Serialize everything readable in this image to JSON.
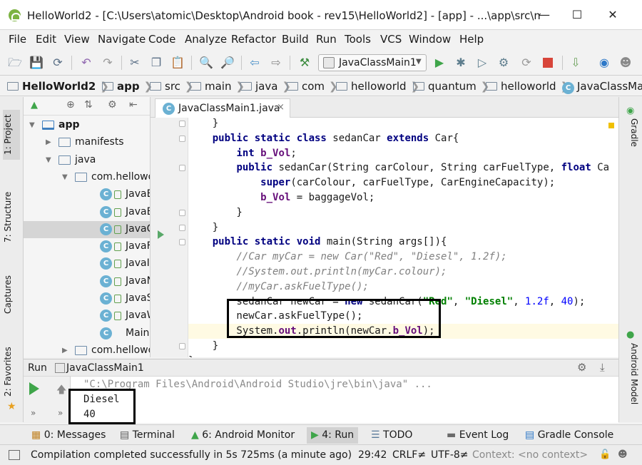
{
  "window": {
    "title": "HelloWorld2 - [C:\\Users\\atomic\\Desktop\\Android book - rev15\\HelloWorld2] - [app] - ...\\app\\src\\main...",
    "minimize": "—",
    "maximize": "☐",
    "close": "✕"
  },
  "menu": [
    "File",
    "Edit",
    "View",
    "Navigate",
    "Code",
    "Analyze",
    "Refactor",
    "Build",
    "Run",
    "Tools",
    "VCS",
    "Window",
    "Help"
  ],
  "toolbar": {
    "run_config": "JavaClassMain1",
    "icons": [
      "open-icon",
      "save-icon",
      "sync-icon",
      "undo-icon",
      "redo-icon",
      "cut-icon",
      "copy-icon",
      "paste-icon",
      "find-icon",
      "replace-icon",
      "back-icon",
      "forward-icon",
      "build-icon",
      "run-icon",
      "debug-icon",
      "coverage-icon",
      "profile-icon",
      "attach-icon",
      "stop-icon",
      "sdk-icon",
      "avatar-icon"
    ]
  },
  "breadcrumb": [
    "HelloWorld2",
    "app",
    "src",
    "main",
    "java",
    "com",
    "helloworld",
    "quantum",
    "helloworld",
    "JavaClassMa"
  ],
  "left_strip": {
    "project": "1: Project",
    "structure": "7: Structure",
    "captures": "Captures",
    "favorites": "2: Favorites"
  },
  "right_strip": {
    "gradle": "Gradle",
    "android_model": "Android Model"
  },
  "project_tree": [
    {
      "label": "app",
      "kind": "module",
      "indent": 0,
      "expanded": true
    },
    {
      "label": "manifests",
      "kind": "folder",
      "indent": 1,
      "expanded": false
    },
    {
      "label": "java",
      "kind": "folder",
      "indent": 1,
      "expanded": true
    },
    {
      "label": "com.hellowo",
      "kind": "package",
      "indent": 2,
      "expanded": true
    },
    {
      "label": "JavaB",
      "kind": "class",
      "indent": 3
    },
    {
      "label": "JavaB",
      "kind": "class",
      "indent": 3
    },
    {
      "label": "JavaC",
      "kind": "class",
      "indent": 3,
      "selected": true
    },
    {
      "label": "JavaF",
      "kind": "class",
      "indent": 3
    },
    {
      "label": "JavaIf",
      "kind": "class",
      "indent": 3
    },
    {
      "label": "JavaN",
      "kind": "class",
      "indent": 3
    },
    {
      "label": "JavaS",
      "kind": "class",
      "indent": 3
    },
    {
      "label": "JavaW",
      "kind": "class",
      "indent": 3
    },
    {
      "label": "Main",
      "kind": "class",
      "indent": 3
    },
    {
      "label": "com.hellowo",
      "kind": "package",
      "indent": 2,
      "expanded": false
    }
  ],
  "editor": {
    "tab": "JavaClassMain1.java",
    "tab_close": "×",
    "lines": [
      [
        {
          "t": "    }",
          "c": ""
        }
      ],
      [
        {
          "t": "    ",
          "c": ""
        },
        {
          "t": "public static class ",
          "c": "kw"
        },
        {
          "t": "sedanCar ",
          "c": ""
        },
        {
          "t": "extends ",
          "c": "kw"
        },
        {
          "t": "Car{",
          "c": ""
        }
      ],
      [
        {
          "t": "        ",
          "c": ""
        },
        {
          "t": "int ",
          "c": "kw"
        },
        {
          "t": "b_Vol",
          "c": "fld"
        },
        {
          "t": ";",
          "c": ""
        }
      ],
      [
        {
          "t": "        ",
          "c": ""
        },
        {
          "t": "public ",
          "c": "kw"
        },
        {
          "t": "sedanCar(String carColour, String carFuelType, ",
          "c": ""
        },
        {
          "t": "float ",
          "c": "kw"
        },
        {
          "t": "Ca",
          "c": ""
        }
      ],
      [
        {
          "t": "            ",
          "c": ""
        },
        {
          "t": "super",
          "c": "kw"
        },
        {
          "t": "(carColour, carFuelType, CarEngineCapacity);",
          "c": ""
        }
      ],
      [
        {
          "t": "            ",
          "c": ""
        },
        {
          "t": "b_Vol",
          "c": "fld"
        },
        {
          "t": " = baggageVol;",
          "c": ""
        }
      ],
      [
        {
          "t": "        }",
          "c": ""
        }
      ],
      [
        {
          "t": "    }",
          "c": ""
        }
      ],
      [
        {
          "t": "    ",
          "c": ""
        },
        {
          "t": "public static void ",
          "c": "kw"
        },
        {
          "t": "main(String args[]){",
          "c": ""
        }
      ],
      [
        {
          "t": "        ",
          "c": ""
        },
        {
          "t": "//Car myCar = new Car(\"Red\", \"Diesel\", 1.2f);",
          "c": "cm"
        }
      ],
      [
        {
          "t": "        ",
          "c": ""
        },
        {
          "t": "//System.out.println(myCar.colour);",
          "c": "cm"
        }
      ],
      [
        {
          "t": "        ",
          "c": ""
        },
        {
          "t": "//myCar.askFuelType();",
          "c": "cm"
        }
      ],
      [
        {
          "t": "        sedanCar newCar = ",
          "c": ""
        },
        {
          "t": "new ",
          "c": "kw"
        },
        {
          "t": "sedanCar(",
          "c": ""
        },
        {
          "t": "\"Red\"",
          "c": "str"
        },
        {
          "t": ", ",
          "c": ""
        },
        {
          "t": "\"Diesel\"",
          "c": "str"
        },
        {
          "t": ", ",
          "c": ""
        },
        {
          "t": "1.2f",
          "c": "num"
        },
        {
          "t": ", ",
          "c": ""
        },
        {
          "t": "40",
          "c": "num"
        },
        {
          "t": ");",
          "c": ""
        }
      ],
      [
        {
          "t": "        newCar.askFuelType();",
          "c": ""
        }
      ],
      [
        {
          "t": "        System.",
          "c": ""
        },
        {
          "t": "out",
          "c": "fld"
        },
        {
          "t": ".println(newCar.",
          "c": ""
        },
        {
          "t": "b_Vol",
          "c": "fld"
        },
        {
          "t": ");",
          "c": ""
        }
      ],
      [
        {
          "t": "    }",
          "c": ""
        }
      ],
      [
        {
          "t": "}",
          "c": ""
        }
      ]
    ]
  },
  "run_panel": {
    "label": "Run",
    "config": "JavaClassMain1",
    "console": [
      "\"C:\\Program Files\\Android\\Android Studio\\jre\\bin\\java\" ...",
      "Diesel",
      "40"
    ]
  },
  "tool_tabs": [
    {
      "label": "0: Messages",
      "icon": "messages-icon"
    },
    {
      "label": "Terminal",
      "icon": "terminal-icon"
    },
    {
      "label": "6: Android Monitor",
      "icon": "android-icon"
    },
    {
      "label": "4: Run",
      "icon": "run-icon",
      "active": true
    },
    {
      "label": "TODO",
      "icon": "todo-icon"
    },
    {
      "label": "Event Log",
      "icon": "event-log-icon"
    },
    {
      "label": "Gradle Console",
      "icon": "gradle-console-icon"
    }
  ],
  "status": {
    "message": "Compilation completed successfully in 5s 725ms (a minute ago)",
    "position": "29:42",
    "line_sep": "CRLF≠",
    "encoding": "UTF-8≠",
    "context": "Context: <no context>"
  }
}
